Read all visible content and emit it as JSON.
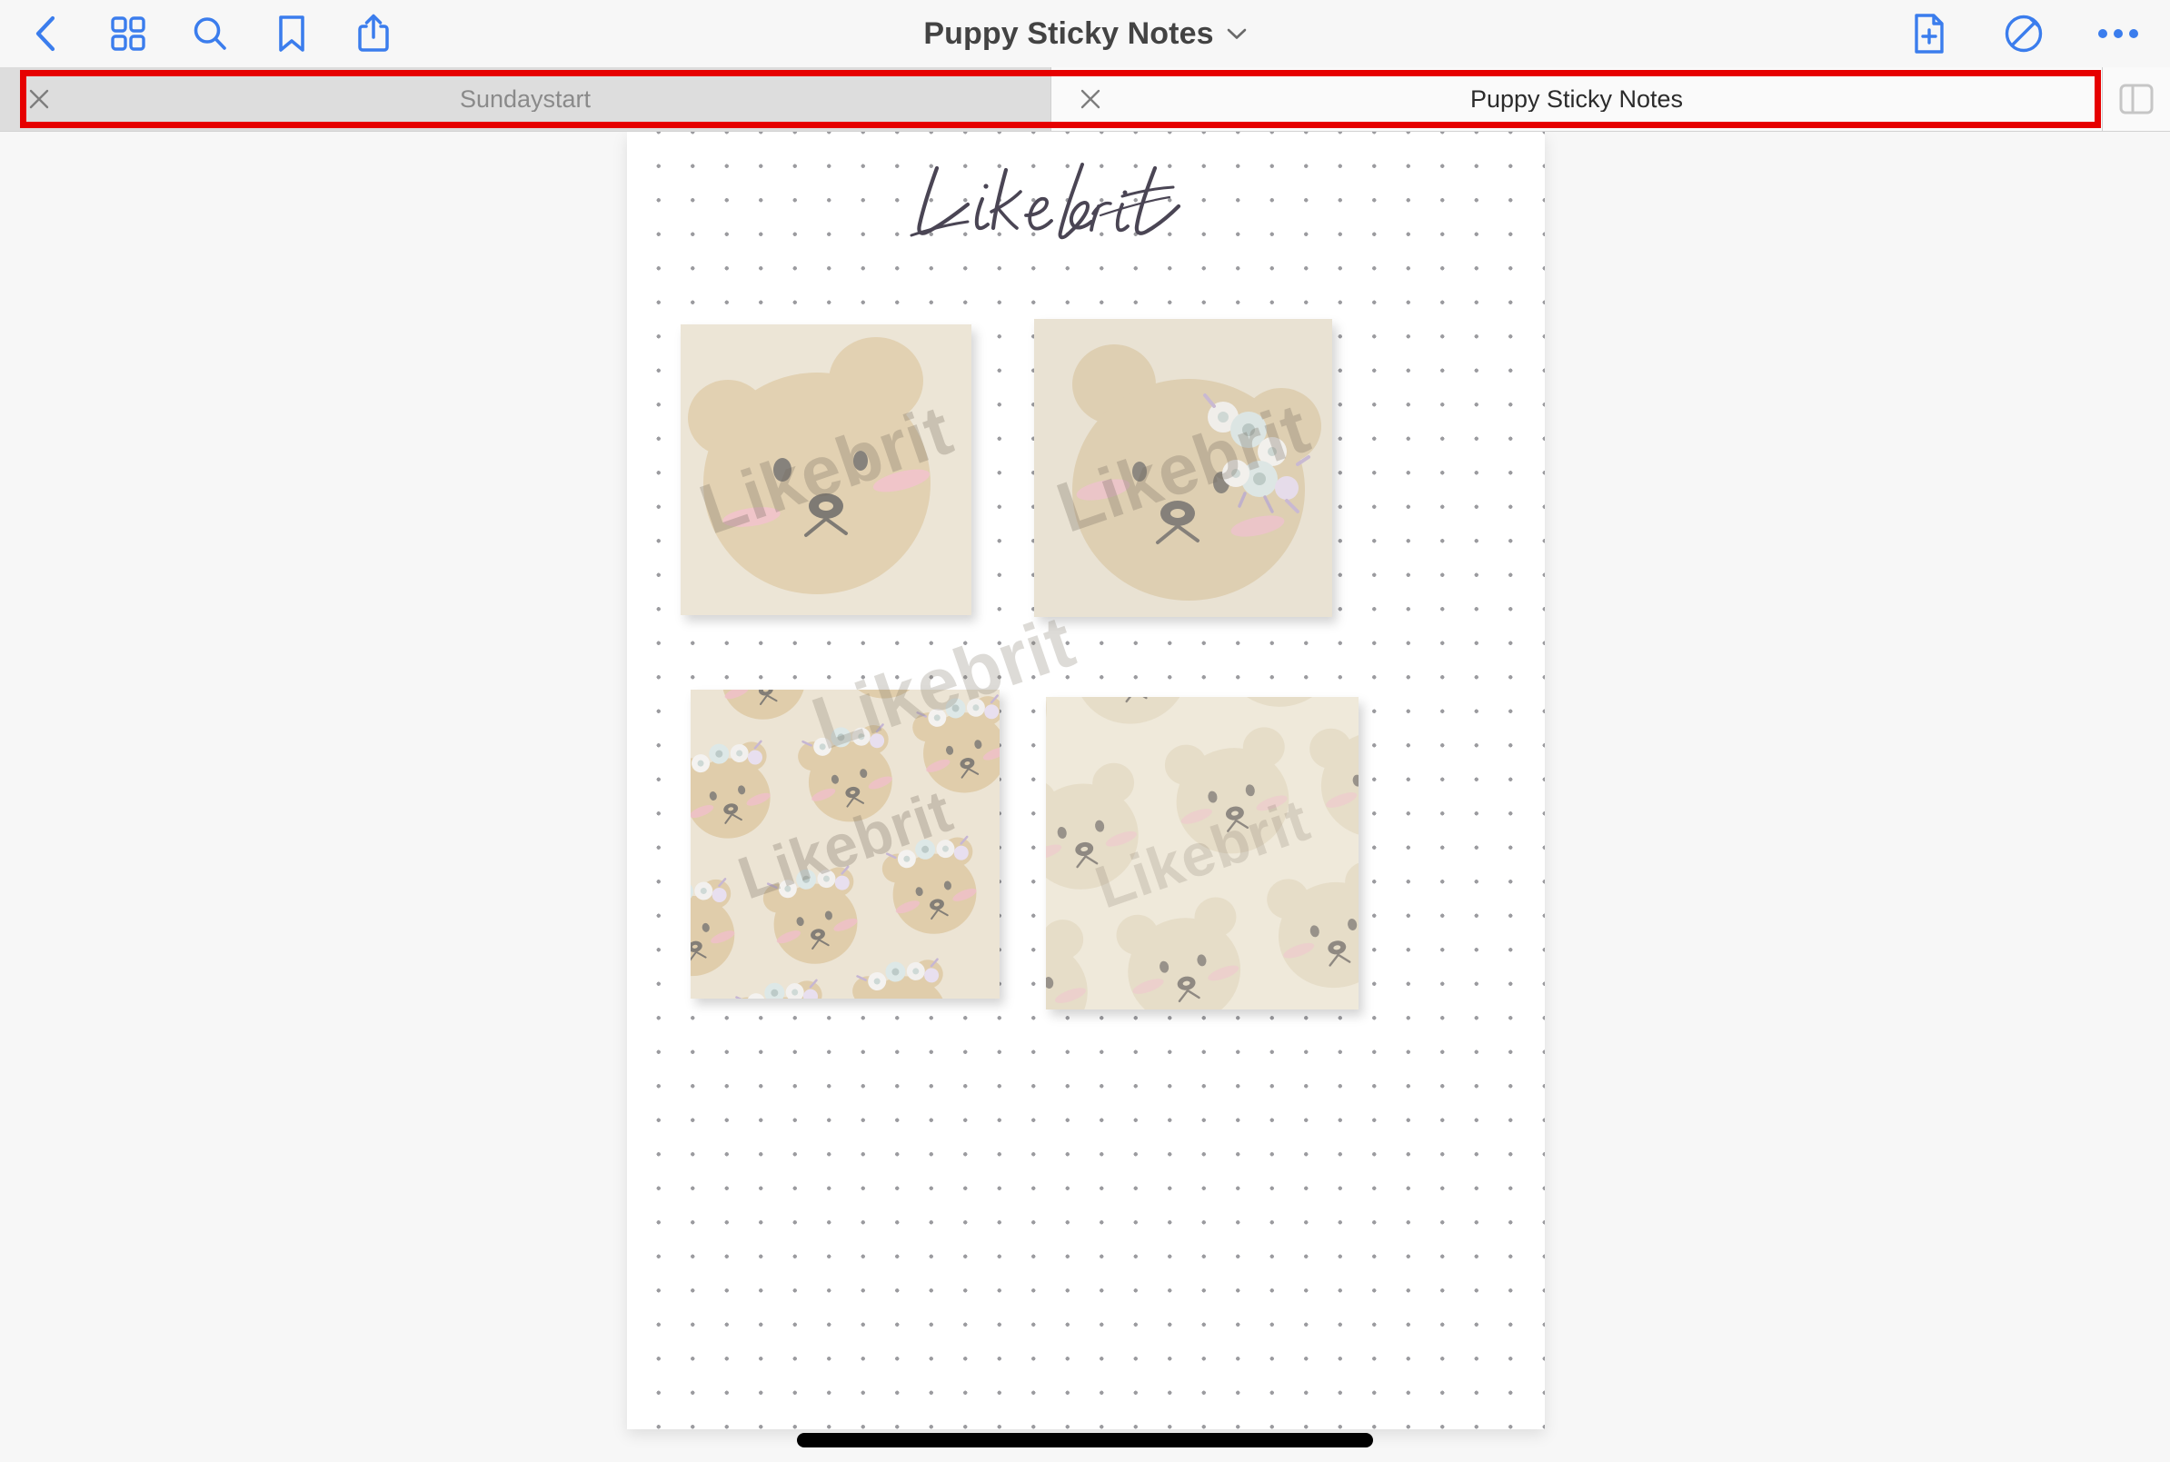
{
  "app": {
    "document_title": "Puppy Sticky Notes"
  },
  "toolbar": {
    "back_icon": "chevron-left-icon",
    "grid_icon": "grid-view-icon",
    "search_icon": "search-icon",
    "bookmark_icon": "bookmark-icon",
    "share_icon": "share-icon",
    "title": "Puppy Sticky Notes",
    "title_chevron_icon": "chevron-down-icon",
    "add_page_icon": "add-page-icon",
    "edit_icon": "edit-pen-icon",
    "more_icon": "more-ellipsis-icon",
    "accent_color": "#3b7ded"
  },
  "tabs": {
    "items": [
      {
        "label": "Sundaystart",
        "active": false,
        "close_icon": "close-icon"
      },
      {
        "label": "Puppy Sticky Notes",
        "active": true,
        "close_icon": "close-icon"
      }
    ],
    "sidebar_toggle_icon": "sidebar-toggle-icon",
    "highlight_color": "#e60000"
  },
  "page": {
    "brand_script": "Likebrit",
    "watermark": "Likebrit",
    "notes": [
      {
        "id": "note-1",
        "name": "bear-face-sticky-note",
        "watermark": "Likebrit",
        "background": "#ece5d6",
        "bear_color": "#e0cfb0"
      },
      {
        "id": "note-2",
        "name": "bear-with-flower-crown-sticky-note",
        "watermark": "Likebrit",
        "background": "#e9e2d3",
        "bear_color": "#ddcdb0"
      },
      {
        "id": "note-3",
        "name": "floral-bear-pattern-sticky-note",
        "watermark": "Likebrit",
        "background": "#ece4d4",
        "bear_color": "#e0cdab"
      },
      {
        "id": "note-4",
        "name": "bear-pattern-sticky-note",
        "watermark": "Likebrit",
        "background": "#efe9da",
        "bear_color": "#e6ddc8"
      }
    ]
  },
  "system": {
    "home_indicator": "home-indicator"
  }
}
